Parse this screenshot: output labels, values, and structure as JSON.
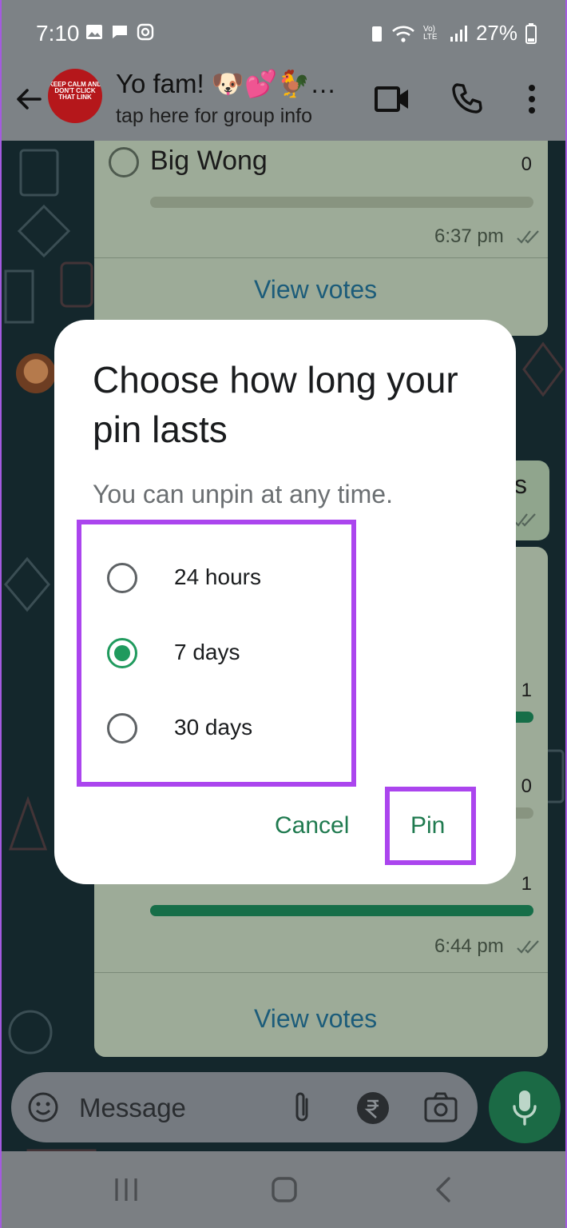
{
  "status_bar": {
    "time": "7:10",
    "battery": "27%",
    "network_label": "Vo) LTE"
  },
  "header": {
    "group_name": "Yo fam! 🐶💕🐓…",
    "subtitle": "tap here for group info",
    "avatar_text": "KEEP CALM AND DON'T CLICK THAT LINK"
  },
  "chat": {
    "poll1": {
      "option_name": "Big Wong",
      "option_count": "0",
      "time": "6:37 pm",
      "view_votes": "View votes"
    },
    "partial_bubble_text": "s",
    "poll2": {
      "counts": [
        "1",
        "0",
        "1"
      ],
      "time": "6:44 pm",
      "view_votes": "View votes"
    }
  },
  "input": {
    "placeholder": "Message"
  },
  "dialog": {
    "title": "Choose how long your pin lasts",
    "description": "You can unpin at any time.",
    "options": [
      {
        "label": "24 hours",
        "selected": false
      },
      {
        "label": "7 days",
        "selected": true
      },
      {
        "label": "30 days",
        "selected": false
      }
    ],
    "cancel_label": "Cancel",
    "pin_label": "Pin"
  },
  "colors": {
    "accent_green": "#1f9a5d",
    "highlight_purple": "#ab45ee"
  }
}
